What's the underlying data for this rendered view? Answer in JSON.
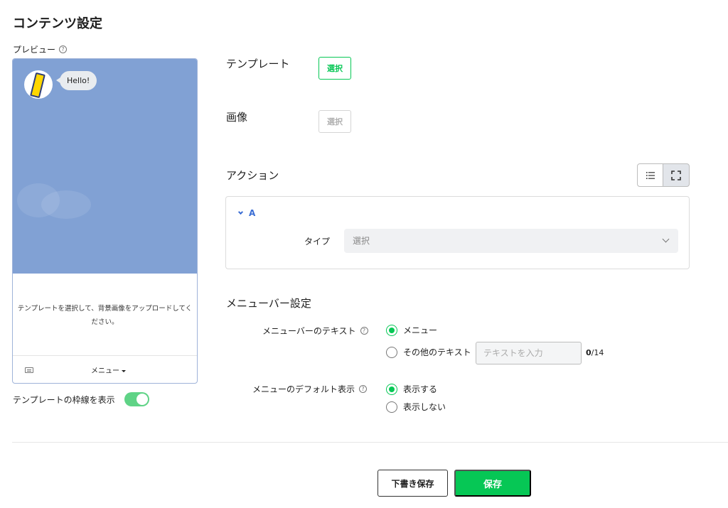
{
  "page": {
    "title": "コンテンツ設定"
  },
  "preview": {
    "label": "プレビュー",
    "bubble_text": "Hello!",
    "message": "テンプレートを選択して、背景画像をアップロードしてください。",
    "menu_label": "メニュー",
    "background_color": "#81a1d4"
  },
  "frame_toggle": {
    "label": "テンプレートの枠線を表示",
    "on": true
  },
  "template": {
    "label": "テンプレート",
    "button": "選択"
  },
  "image": {
    "label": "画像",
    "button": "選択"
  },
  "action": {
    "label": "アクション",
    "item_name": "A",
    "type_label": "タイプ",
    "type_placeholder": "選択"
  },
  "menubar": {
    "title": "メニューバー設定",
    "text_label": "メニューバーのテキスト",
    "text_option_menu": "メニュー",
    "text_option_other": "その他のテキスト",
    "text_input_placeholder": "テキストを入力",
    "count_current": "0",
    "count_max": "/14",
    "default_label": "メニューのデフォルト表示",
    "default_option_show": "表示する",
    "default_option_hide": "表示しない"
  },
  "footer": {
    "draft_button": "下書き保存",
    "save_button": "保存"
  },
  "colors": {
    "accent": "#06c755",
    "link": "#3a6dd4"
  }
}
